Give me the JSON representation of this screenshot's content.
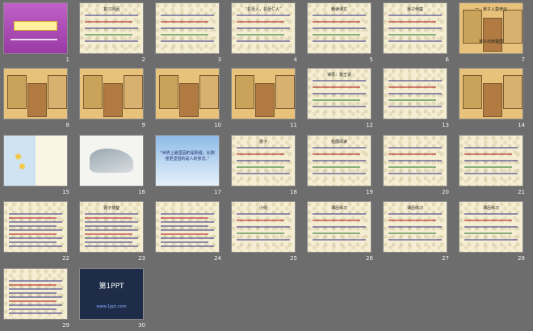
{
  "slides": [
    {
      "n": "1",
      "kind": "cover",
      "text": "",
      "sub": ""
    },
    {
      "n": "2",
      "kind": "text",
      "text": "复习巩固"
    },
    {
      "n": "3",
      "kind": "text",
      "text": ""
    },
    {
      "n": "4",
      "kind": "text",
      "text": "“名至人，名至仁人”"
    },
    {
      "n": "5",
      "kind": "text",
      "text": "精读课文"
    },
    {
      "n": "6",
      "kind": "text",
      "text": "晏子使楚"
    },
    {
      "n": "7",
      "kind": "comic",
      "text": "一、晏子入楚使记",
      "sub": "晏子出使楚国"
    },
    {
      "n": "8",
      "kind": "comic",
      "text": ""
    },
    {
      "n": "9",
      "kind": "comic",
      "text": ""
    },
    {
      "n": "10",
      "kind": "comic",
      "text": ""
    },
    {
      "n": "11",
      "kind": "comic",
      "text": ""
    },
    {
      "n": "12",
      "kind": "text",
      "text": "读思：楚王说"
    },
    {
      "n": "13",
      "kind": "text",
      "text": ""
    },
    {
      "n": "14",
      "kind": "comic",
      "text": ""
    },
    {
      "n": "15",
      "kind": "flower",
      "text": ""
    },
    {
      "n": "16",
      "kind": "landscape",
      "text": ""
    },
    {
      "n": "17",
      "kind": "sky",
      "text": "“世界上最坚固的是刚强，比刚强更坚固的是人的意志。”"
    },
    {
      "n": "18",
      "kind": "text",
      "text": "晏子"
    },
    {
      "n": "19",
      "kind": "text",
      "text": "拓展阅读"
    },
    {
      "n": "20",
      "kind": "text",
      "text": ""
    },
    {
      "n": "21",
      "kind": "text",
      "text": ""
    },
    {
      "n": "22",
      "kind": "dense",
      "text": ""
    },
    {
      "n": "23",
      "kind": "dense",
      "text": "晏子使楚"
    },
    {
      "n": "24",
      "kind": "dense",
      "text": ""
    },
    {
      "n": "25",
      "kind": "text",
      "text": "小结"
    },
    {
      "n": "26",
      "kind": "text",
      "text": "课后练习"
    },
    {
      "n": "27",
      "kind": "text",
      "text": "课后练习"
    },
    {
      "n": "28",
      "kind": "text",
      "text": "课后练习"
    },
    {
      "n": "29",
      "kind": "dense",
      "text": ""
    },
    {
      "n": "30",
      "kind": "brand",
      "text": "第1PPT",
      "sub": "www.1ppt.com"
    }
  ]
}
